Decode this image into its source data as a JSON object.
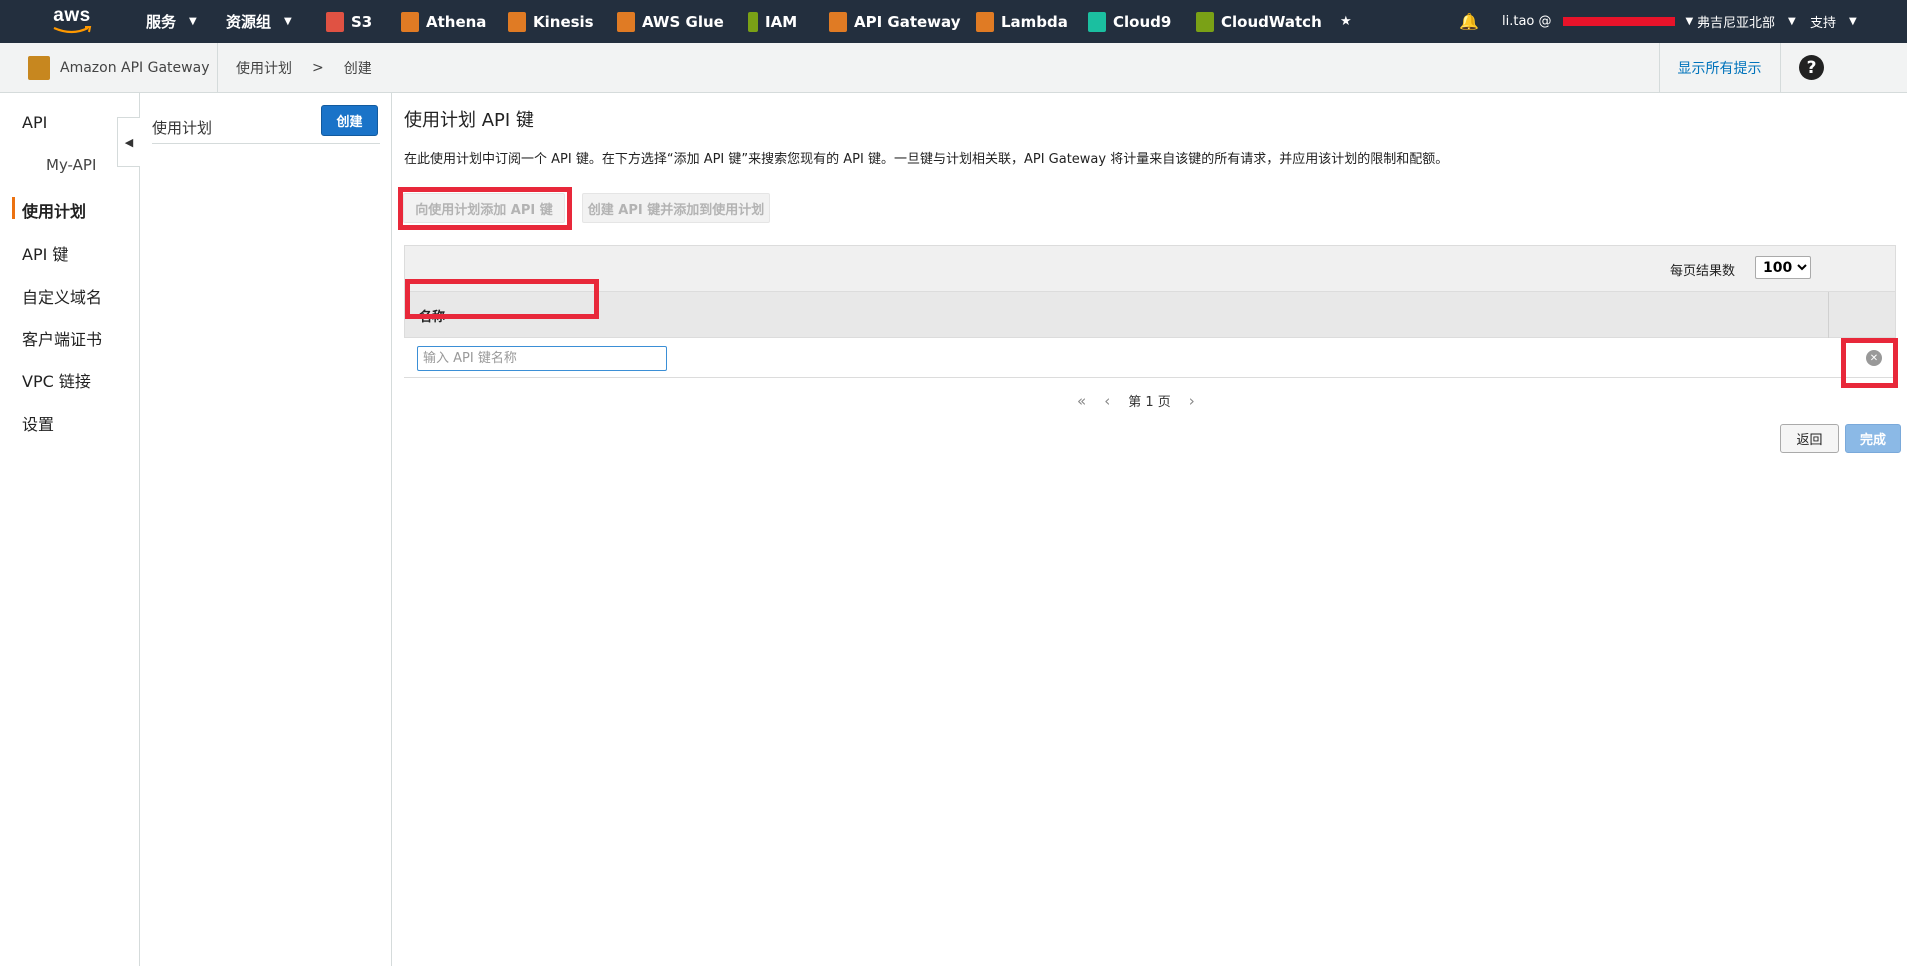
{
  "topnav": {
    "logo_text": "aws",
    "services_label": "服务",
    "resource_groups_label": "资源组",
    "shortcuts": [
      {
        "label": "S3",
        "color": "#e05243"
      },
      {
        "label": "Athena",
        "color": "#e07b24"
      },
      {
        "label": "Kinesis",
        "color": "#e07b24"
      },
      {
        "label": "AWS Glue",
        "color": "#e07b24"
      },
      {
        "label": "IAM",
        "color": "#7aa116"
      },
      {
        "label": "API Gateway",
        "color": "#e07b24"
      },
      {
        "label": "Lambda",
        "color": "#e07b24"
      },
      {
        "label": "Cloud9",
        "color": "#1bbfa0"
      },
      {
        "label": "CloudWatch",
        "color": "#7aa116"
      }
    ],
    "user_label": "li.tao @",
    "region_label": "弗吉尼亚北部",
    "support_label": "支持"
  },
  "subheader": {
    "brand": "Amazon API Gateway",
    "breadcrumb": [
      "使用计划",
      ">",
      "创建"
    ],
    "hints_link": "显示所有提示",
    "help_glyph": "?"
  },
  "leftnav": {
    "items": [
      "API",
      "My-API",
      "使用计划",
      "API 键",
      "自定义域名",
      "客户端证书",
      "VPC 链接",
      "设置"
    ],
    "active": "使用计划"
  },
  "plan_panel": {
    "title": "使用计划",
    "create_button": "创建"
  },
  "main": {
    "title": "使用计划 API 键",
    "description": "在此使用计划中订阅一个 API 键。在下方选择“添加 API 键”来搜索您现有的 API 键。一旦键与计划相关联，API Gateway 将计量来自该键的所有请求，并应用该计划的限制和配额。",
    "add_key_button": "向使用计划添加 API 键",
    "create_key_button": "创建 API 键并添加到使用计划",
    "per_page_label": "每页结果数",
    "per_page_value": "100",
    "column_name": "名称",
    "input_placeholder": "输入 API 键名称",
    "pager_text": "第 1 页",
    "back_button": "返回",
    "done_button": "完成"
  },
  "colors": {
    "nav_bg": "#232f3e",
    "highlight": "#e8283a",
    "primary": "#1a73c8",
    "active_bar": "#ec7211"
  }
}
